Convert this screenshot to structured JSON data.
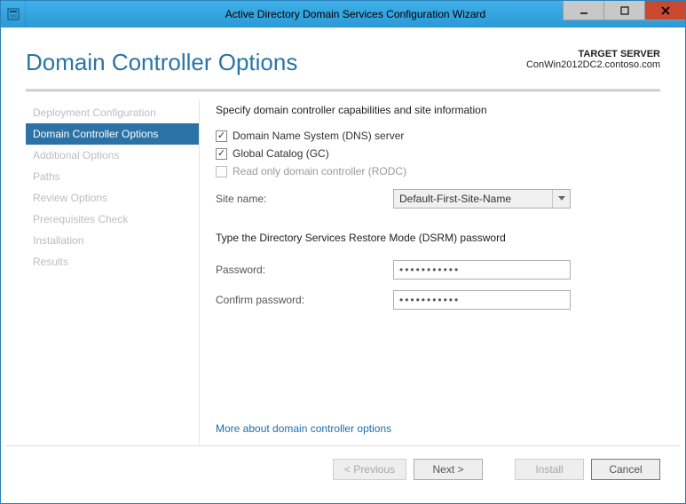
{
  "window": {
    "title": "Active Directory Domain Services Configuration Wizard"
  },
  "header": {
    "title": "Domain Controller Options",
    "target_label": "TARGET SERVER",
    "target_server": "ConWin2012DC2.contoso.com"
  },
  "nav": {
    "items": [
      {
        "label": "Deployment Configuration",
        "active": false
      },
      {
        "label": "Domain Controller Options",
        "active": true
      },
      {
        "label": "Additional Options",
        "active": false
      },
      {
        "label": "Paths",
        "active": false
      },
      {
        "label": "Review Options",
        "active": false
      },
      {
        "label": "Prerequisites Check",
        "active": false
      },
      {
        "label": "Installation",
        "active": false
      },
      {
        "label": "Results",
        "active": false
      }
    ]
  },
  "content": {
    "caps_heading": "Specify domain controller capabilities and site information",
    "checkboxes": {
      "dns": {
        "label": "Domain Name System (DNS) server",
        "checked": true,
        "disabled": false
      },
      "gc": {
        "label": "Global Catalog (GC)",
        "checked": true,
        "disabled": false
      },
      "rodc": {
        "label": "Read only domain controller (RODC)",
        "checked": false,
        "disabled": true
      }
    },
    "site_label": "Site name:",
    "site_value": "Default-First-Site-Name",
    "dsrm_heading": "Type the Directory Services Restore Mode (DSRM) password",
    "pw_label": "Password:",
    "pw_value": "•••••••••••",
    "pw2_label": "Confirm password:",
    "pw2_value": "•••••••••••",
    "more_link": "More about domain controller options"
  },
  "footer": {
    "prev": "< Previous",
    "next": "Next >",
    "install": "Install",
    "cancel": "Cancel"
  }
}
